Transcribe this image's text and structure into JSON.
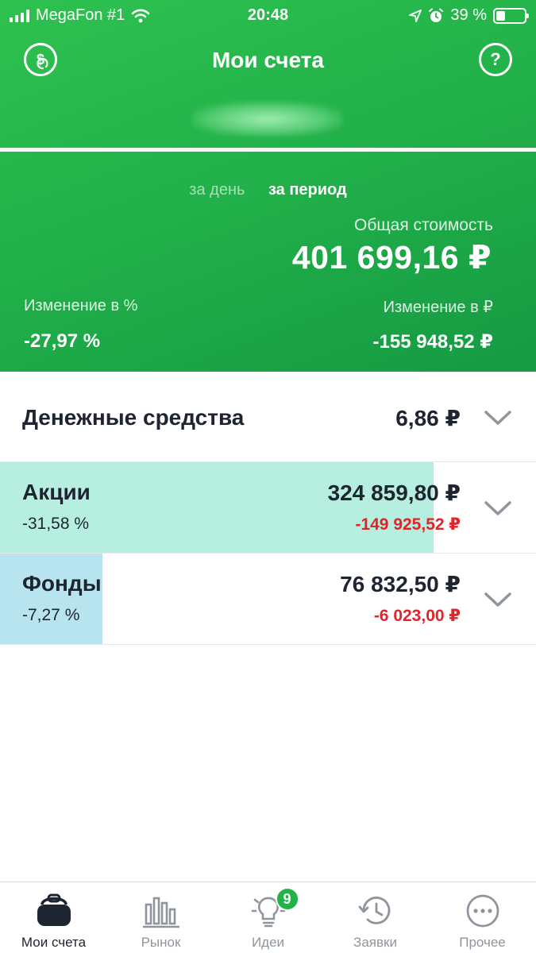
{
  "status_bar": {
    "carrier": "MegaFon #1",
    "time": "20:48",
    "battery": "39 %",
    "battery_level": 0.39
  },
  "header": {
    "title": "Мои счета",
    "left_icon": "dollar-refresh-icon",
    "help_label": "?"
  },
  "summary": {
    "period_day": "за день",
    "period_range": "за период",
    "selected_period": "за период",
    "total_label": "Общая стоимость",
    "total_value": "401 699,16 ₽",
    "change_pct_label": "Изменение в %",
    "change_pct_value": "-27,97 %",
    "change_rub_label": "Изменение в ₽",
    "change_rub_value": "-155 948,52 ₽"
  },
  "assets": [
    {
      "name": "Денежные средства",
      "amount": "6,86 ₽",
      "change_pct": "",
      "change_rub": "",
      "share": 0,
      "fill_color": ""
    },
    {
      "name": "Акции",
      "amount": "324 859,80 ₽",
      "change_pct": "-31,58 %",
      "change_rub": "-149 925,52 ₽",
      "share": 0.809,
      "fill_color": "#b6eedf"
    },
    {
      "name": "Фонды",
      "amount": "76 832,50 ₽",
      "change_pct": "-7,27 %",
      "change_rub": "-6 023,00 ₽",
      "share": 0.191,
      "fill_color": "#b7e4ee"
    }
  ],
  "tab_bar": {
    "items": [
      {
        "label": "Мои счета",
        "icon": "wallet-icon",
        "active": true
      },
      {
        "label": "Рынок",
        "icon": "market-chart-icon",
        "active": false
      },
      {
        "label": "Идеи",
        "icon": "lightbulb-icon",
        "active": false,
        "badge": "9"
      },
      {
        "label": "Заявки",
        "icon": "history-icon",
        "active": false
      },
      {
        "label": "Прочее",
        "icon": "more-icon",
        "active": false
      }
    ]
  },
  "colors": {
    "brand_green": "#22b24a",
    "negative": "#e0242a",
    "text_dark": "#1e2430",
    "text_muted": "#8f959c"
  }
}
